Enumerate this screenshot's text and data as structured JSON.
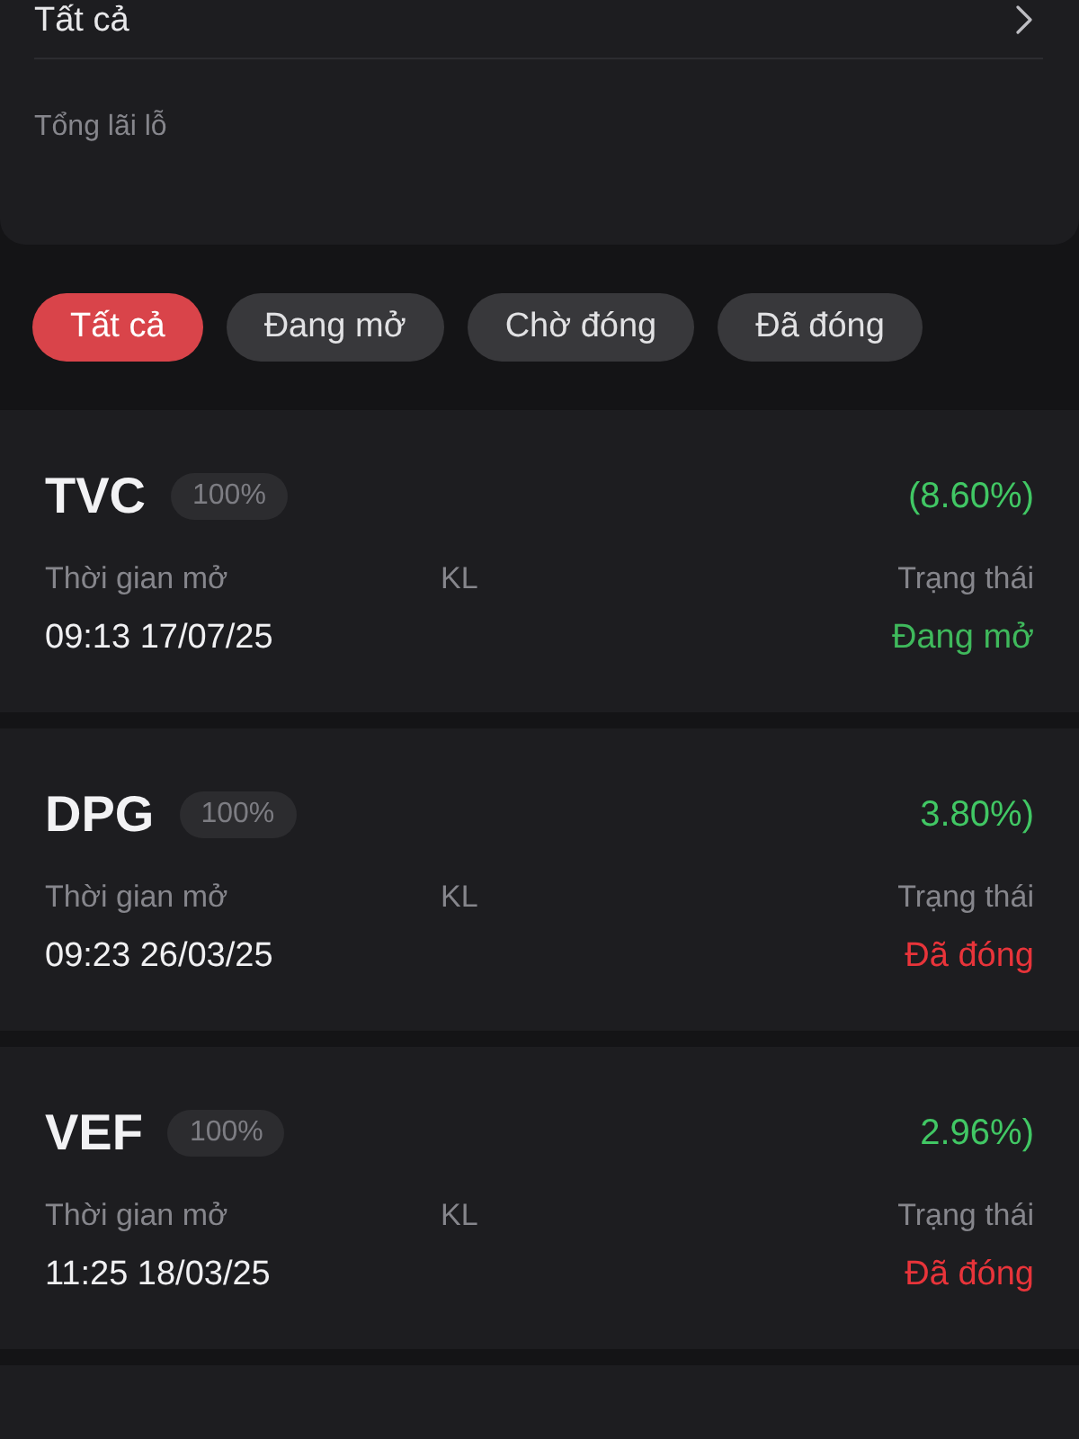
{
  "filter_panel": {
    "selection": "Tất cả",
    "total_label": "Tổng lãi lỗ"
  },
  "tabs": [
    {
      "label": "Tất cả",
      "selected": true
    },
    {
      "label": "Đang mở",
      "selected": false
    },
    {
      "label": "Chờ đóng",
      "selected": false
    },
    {
      "label": "Đã đóng",
      "selected": false
    }
  ],
  "positions": [
    {
      "symbol": "TVC",
      "allocation": "100%",
      "pnl": "(8.60%)",
      "time_label": "Thời gian mở",
      "time": "09:13 17/07/25",
      "volume_label": "KL",
      "status_label": "Trạng thái",
      "status": {
        "text": "Đang mở",
        "color": "#3fb95c"
      }
    },
    {
      "symbol": "DPG",
      "allocation": "100%",
      "pnl": "3.80%)",
      "time_label": "Thời gian mở",
      "time": "09:23 26/03/25",
      "volume_label": "KL",
      "status_label": "Trạng thái",
      "status": {
        "text": "Đã đóng",
        "color": "#e8343a"
      }
    },
    {
      "symbol": "VEF",
      "allocation": "100%",
      "pnl": "2.96%)",
      "time_label": "Thời gian mở",
      "time": "11:25 18/03/25",
      "volume_label": "KL",
      "status_label": "Trạng thái",
      "status": {
        "text": "Đã đóng",
        "color": "#e8343a"
      }
    }
  ]
}
